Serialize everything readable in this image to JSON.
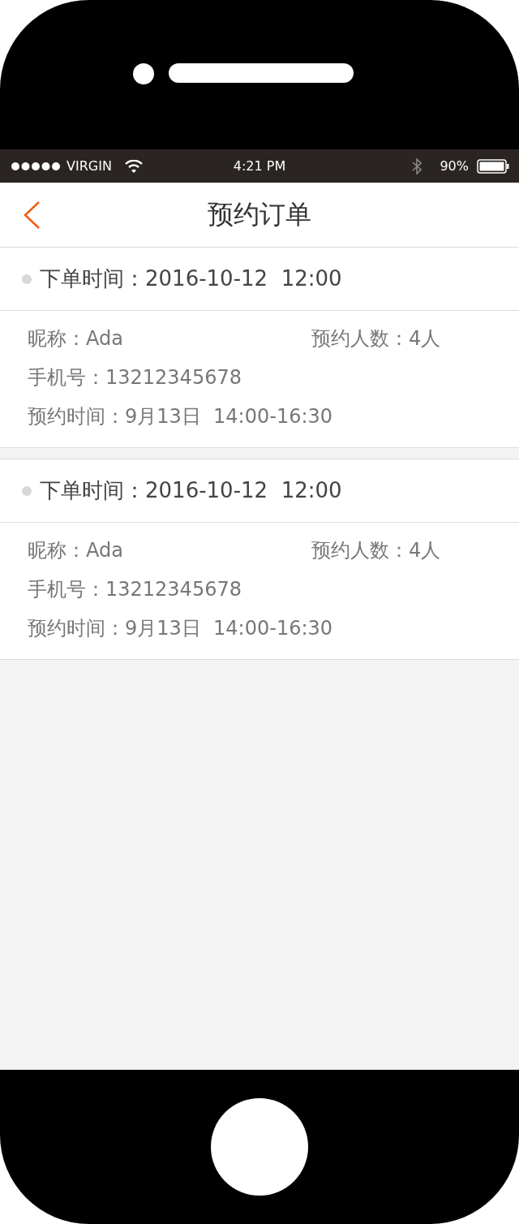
{
  "status_bar": {
    "carrier": "VIRGIN",
    "time": "4:21 PM",
    "battery": "90%"
  },
  "nav": {
    "title": "预约订单"
  },
  "orders": [
    {
      "order_time": "下单时间：2016-10-12  12:00",
      "nickname": "昵称：Ada",
      "party_size": "预约人数：4人",
      "phone": "手机号：13212345678",
      "booking_time": "预约时间：9月13日  14:00-16:30"
    },
    {
      "order_time": "下单时间：2016-10-12  12:00",
      "nickname": "昵称：Ada",
      "party_size": "预约人数：4人",
      "phone": "手机号：13212345678",
      "booking_time": "预约时间：9月13日  14:00-16:30"
    }
  ]
}
